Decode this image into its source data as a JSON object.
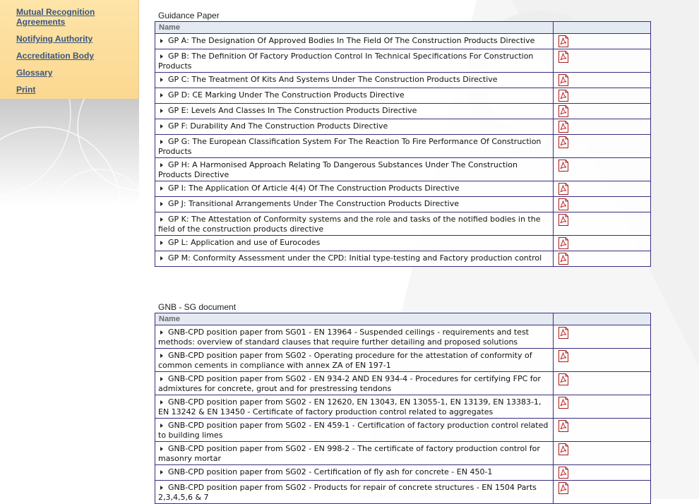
{
  "sidebar": {
    "links": [
      {
        "label": "Mutual Recognition Agreements"
      },
      {
        "label": "Notifying Authority"
      },
      {
        "label": "Accreditation Body"
      },
      {
        "label": "Glossary"
      },
      {
        "label": "Print"
      }
    ]
  },
  "sections": [
    {
      "title": "Guidance Paper",
      "column_name": "Name",
      "rows": [
        {
          "text": "GP A: The Designation Of Approved Bodies In The Field Of The Construction Products Directive",
          "icon": "pdf-icon"
        },
        {
          "text": "GP B: The Definition Of Factory Production Control In Technical Specifications For Construction Products",
          "icon": "pdf-icon"
        },
        {
          "text": "GP C: The Treatment Of Kits And Systems Under The Construction Products Directive",
          "icon": "pdf-icon"
        },
        {
          "text": "GP D: CE Marking Under The Construction Products Directive",
          "icon": "pdf-icon"
        },
        {
          "text": "GP E: Levels And Classes In The Construction Products Directive",
          "icon": "pdf-icon"
        },
        {
          "text": "GP F: Durability And The Construction Products Directive",
          "icon": "pdf-icon"
        },
        {
          "text": "GP G: The European Classification System For The Reaction To Fire Performance Of Construction Products",
          "icon": "pdf-icon"
        },
        {
          "text": "GP H: A Harmonised Approach Relating To Dangerous Substances Under The Construction Products Directive",
          "icon": "pdf-icon"
        },
        {
          "text": "GP I: The Application Of Article 4(4) Of The Construction Products Directive",
          "icon": "pdf-icon"
        },
        {
          "text": "GP J: Transitional Arrangements Under The Construction Products Directive",
          "icon": "pdf-icon"
        },
        {
          "text": "GP K: The Attestation of Conformity systems and the role and tasks of the notified bodies in the field of the construction products directive",
          "icon": "pdf-icon"
        },
        {
          "text": "GP L: Application and use of Eurocodes",
          "icon": "pdf-icon"
        },
        {
          "text": "GP M: Conformity Assessment under the CPD: Initial type-testing and Factory production control",
          "icon": "pdf-icon"
        }
      ]
    },
    {
      "title": "GNB - SG document",
      "column_name": "Name",
      "rows": [
        {
          "text": "GNB-CPD position paper from SG01 - EN 13964 - Suspended ceilings - requirements and test methods: overview of standard clauses that require further detailing and proposed solutions",
          "icon": "pdf-icon"
        },
        {
          "text": "GNB-CPD position paper from SG02 - Operating procedure for the attestation of conformity of common cements in compliance with annex ZA of EN 197-1",
          "icon": "pdf-icon"
        },
        {
          "text": "GNB-CPD position paper from SG02 - EN 934-2 AND EN 934-4 - Procedures for certifying FPC for admixtures for concrete, grout and for prestressing tendons",
          "icon": "pdf-icon"
        },
        {
          "text": "GNB-CPD position paper from SG02 - EN 12620, EN 13043, EN 13055-1, EN 13139, EN 13383-1, EN 13242 & EN 13450 - Certificate of factory production control related to aggregates",
          "icon": "pdf-icon"
        },
        {
          "text": "GNB-CPD position paper from SG02 - EN 459-1 - Certification of factory production control related to building limes",
          "icon": "pdf-icon"
        },
        {
          "text": "GNB-CPD position paper from SG02 - EN 998-2 - The certificate of factory production control for masonry mortar",
          "icon": "pdf-icon"
        },
        {
          "text": "GNB-CPD position paper from SG02 - Certification of fly ash for concrete - EN 450-1",
          "icon": "pdf-icon"
        },
        {
          "text": "GNB-CPD position paper from SG02 - Products for repair of concrete structures - EN 1504 Parts 2,3,4,5,6 & 7",
          "icon": "pdf-icon"
        }
      ]
    }
  ]
}
